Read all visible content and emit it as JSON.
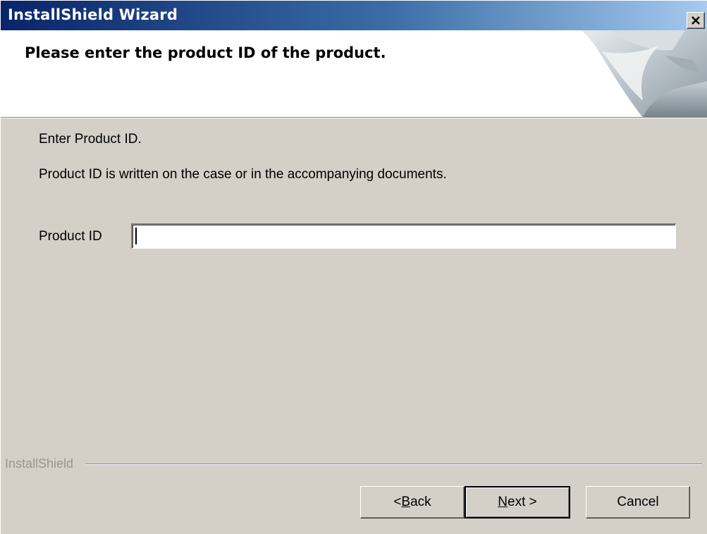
{
  "window": {
    "title": "InstallShield Wizard",
    "close_glyph": "✕"
  },
  "banner": {
    "heading": "Please enter the product ID of the product."
  },
  "content": {
    "line1": "Enter Product ID.",
    "line2": "Product ID is written on the case or in the accompanying documents.",
    "field_label": "Product ID",
    "field_value": ""
  },
  "footer": {
    "brand": "InstallShield",
    "back": {
      "accel": "B",
      "text": "< Back",
      "prefix": "< ",
      "rest": "ack"
    },
    "next": {
      "accel": "N",
      "text": "Next >",
      "rest": "ext >"
    },
    "cancel": "Cancel"
  },
  "colors": {
    "title_start": "#0a246a",
    "title_end": "#a6caf0",
    "face": "#d4d0c8"
  },
  "icons": {
    "close": "close-icon",
    "banner": "installshield-banner-graphic"
  }
}
